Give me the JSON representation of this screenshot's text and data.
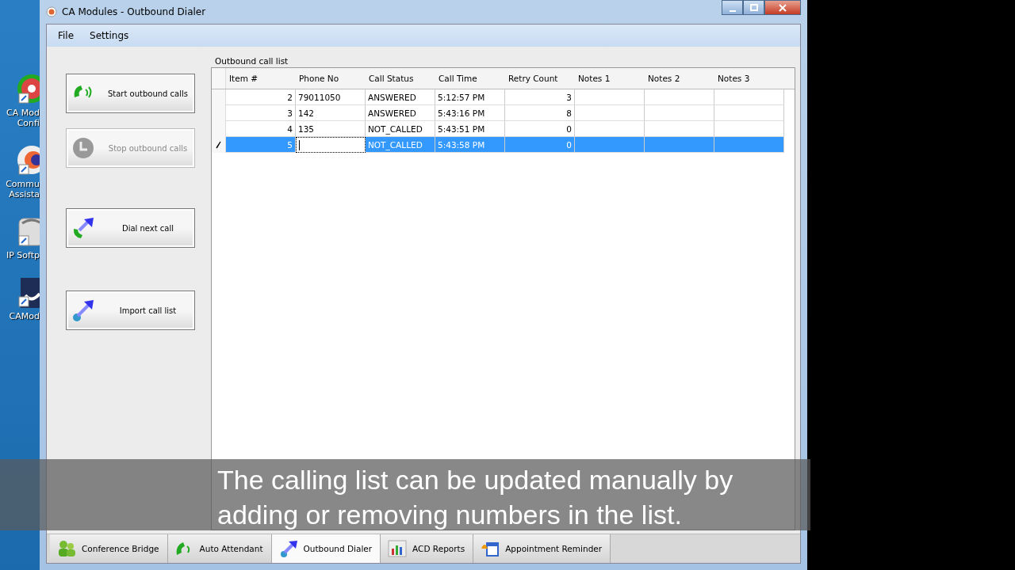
{
  "desktop_icons": [
    {
      "kind": "ring",
      "label": [
        "CA Mod",
        "Confi"
      ]
    },
    {
      "kind": "badge",
      "label": [
        "Commu",
        "Assista"
      ]
    },
    {
      "kind": "phone",
      "label": [
        "IP Softp"
      ]
    },
    {
      "kind": "arrows",
      "label": [
        "CAMod"
      ]
    }
  ],
  "window": {
    "title": "CA Modules - Outbound Dialer"
  },
  "menu": [
    "File",
    "Settings"
  ],
  "actions": [
    {
      "kind": "start",
      "label": "Start outbound calls",
      "disabled": false
    },
    {
      "kind": "stop",
      "label": "Stop outbound calls",
      "disabled": true
    },
    {
      "kind": "dial",
      "label": "Dial next call",
      "disabled": false
    },
    {
      "kind": "import",
      "label": "Import call list",
      "disabled": false
    }
  ],
  "call_list": {
    "title": "Outbound call list",
    "columns": [
      "Item #",
      "Phone No",
      "Call Status",
      "Call Time",
      "Retry Count",
      "Notes 1",
      "Notes 2",
      "Notes 3"
    ],
    "rows": [
      {
        "cells": [
          "2",
          "79011050",
          "ANSWERED",
          "5:12:57 PM",
          "3",
          "",
          "",
          ""
        ],
        "selected": false,
        "editing": false
      },
      {
        "cells": [
          "3",
          "142",
          "ANSWERED",
          "5:43:16 PM",
          "8",
          "",
          "",
          ""
        ],
        "selected": false,
        "editing": false
      },
      {
        "cells": [
          "4",
          "135",
          "NOT_CALLED",
          "5:43:51 PM",
          "0",
          "",
          "",
          ""
        ],
        "selected": false,
        "editing": false
      },
      {
        "cells": [
          "5",
          "",
          "NOT_CALLED",
          "5:43:58 PM",
          "0",
          "",
          "",
          ""
        ],
        "selected": true,
        "editing": true
      }
    ]
  },
  "tabs": [
    {
      "kind": "people",
      "label": "Conference Bridge",
      "selected": false
    },
    {
      "kind": "handset",
      "label": "Auto Attendant",
      "selected": false
    },
    {
      "kind": "dialer",
      "label": "Outbound Dialer",
      "selected": true
    },
    {
      "kind": "chart",
      "label": "ACD Reports",
      "selected": false
    },
    {
      "kind": "calendar",
      "label": "Appointment Reminder",
      "selected": false
    }
  ],
  "caption": "The calling list can be updated manually by adding or removing numbers in the list."
}
